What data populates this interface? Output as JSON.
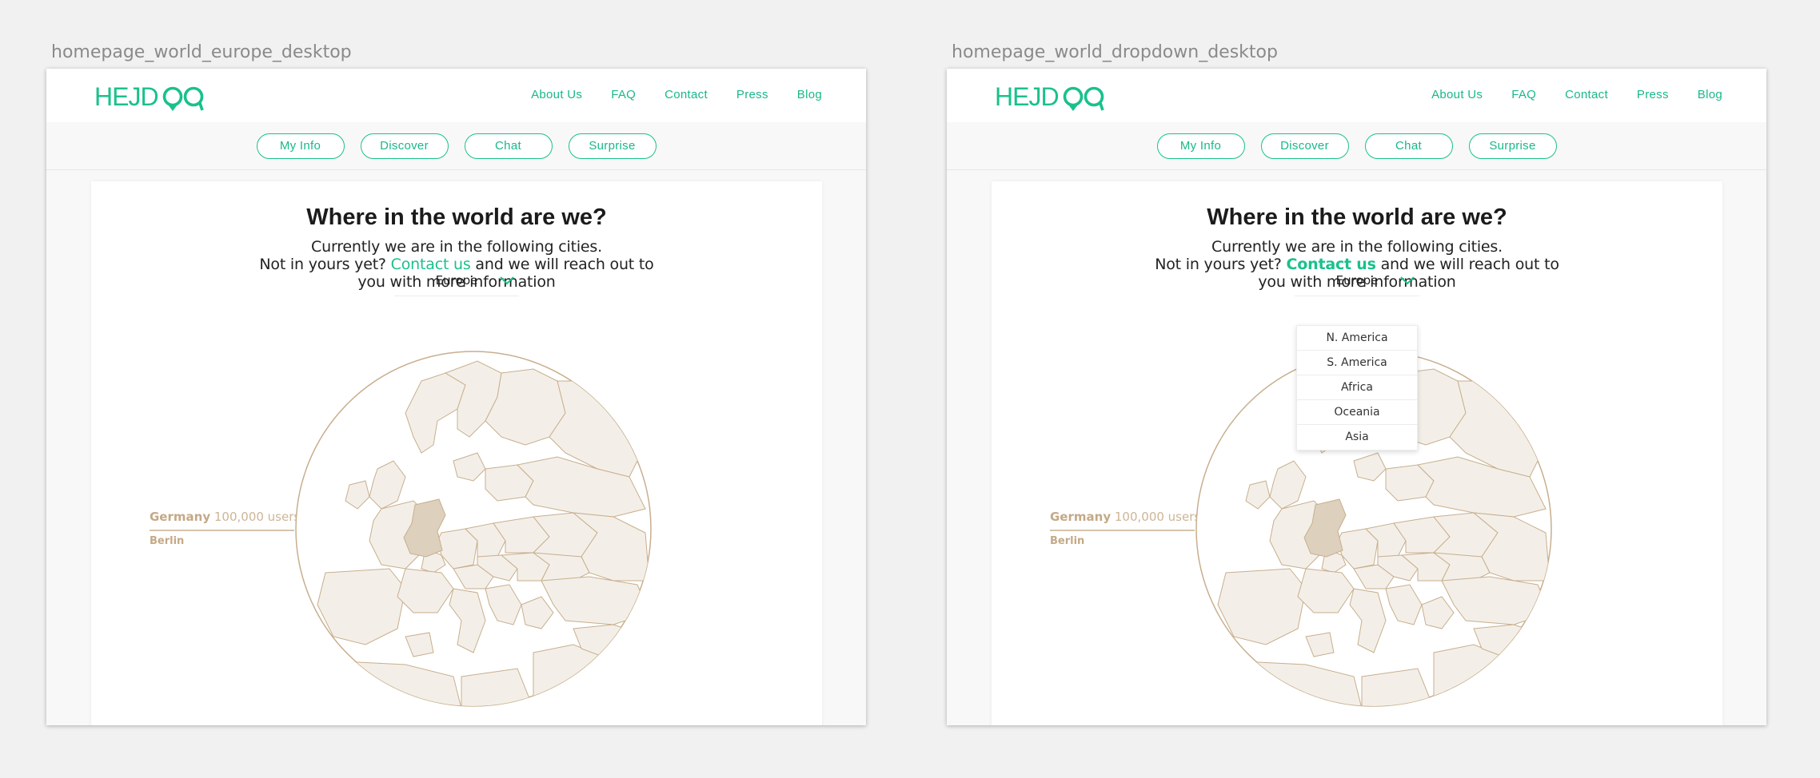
{
  "artboards": [
    {
      "label": "homepage_world_europe_desktop",
      "logo": "HEJDOO",
      "nav": [
        "About Us",
        "FAQ",
        "Contact",
        "Press",
        "Blog"
      ],
      "tabs": [
        "My Info",
        "Discover",
        "Chat",
        "Surprise"
      ],
      "title": "Where in the world are we?",
      "desc_line1": "Currently we are in the following cities.",
      "desc_line2_pre": "Not in yours yet? ",
      "desc_link": "Contact us",
      "desc_line2_post": " and we will reach out to",
      "desc_line3": "you with more information",
      "region_select": "Europe",
      "country": "Germany",
      "users": "100,000 users",
      "city": "Berlin",
      "dropdown_open": false
    },
    {
      "label": "homepage_world_dropdown_desktop",
      "logo": "HEJDOO",
      "nav": [
        "About Us",
        "FAQ",
        "Contact",
        "Press",
        "Blog"
      ],
      "tabs": [
        "My Info",
        "Discover",
        "Chat",
        "Surprise"
      ],
      "title": "Where in the world are we?",
      "desc_line1": "Currently we are in the following cities.",
      "desc_line2_pre": "Not in yours yet? ",
      "desc_link": "Contact us",
      "desc_line2_post": " and we will reach out to",
      "desc_line3": "you with more information",
      "region_select": "Europe",
      "dropdown_options": [
        "N. America",
        "S. America",
        "Africa",
        "Oceania",
        "Asia"
      ],
      "country": "Germany",
      "users": "100,000 users",
      "city": "Berlin",
      "dropdown_open": true
    }
  ],
  "colors": {
    "brand": "#19c18b",
    "map_fill": "#f3efe8",
    "map_stroke": "#c8ae8d",
    "highlight_country": "#ddd0bd",
    "label": "#c4a986"
  }
}
